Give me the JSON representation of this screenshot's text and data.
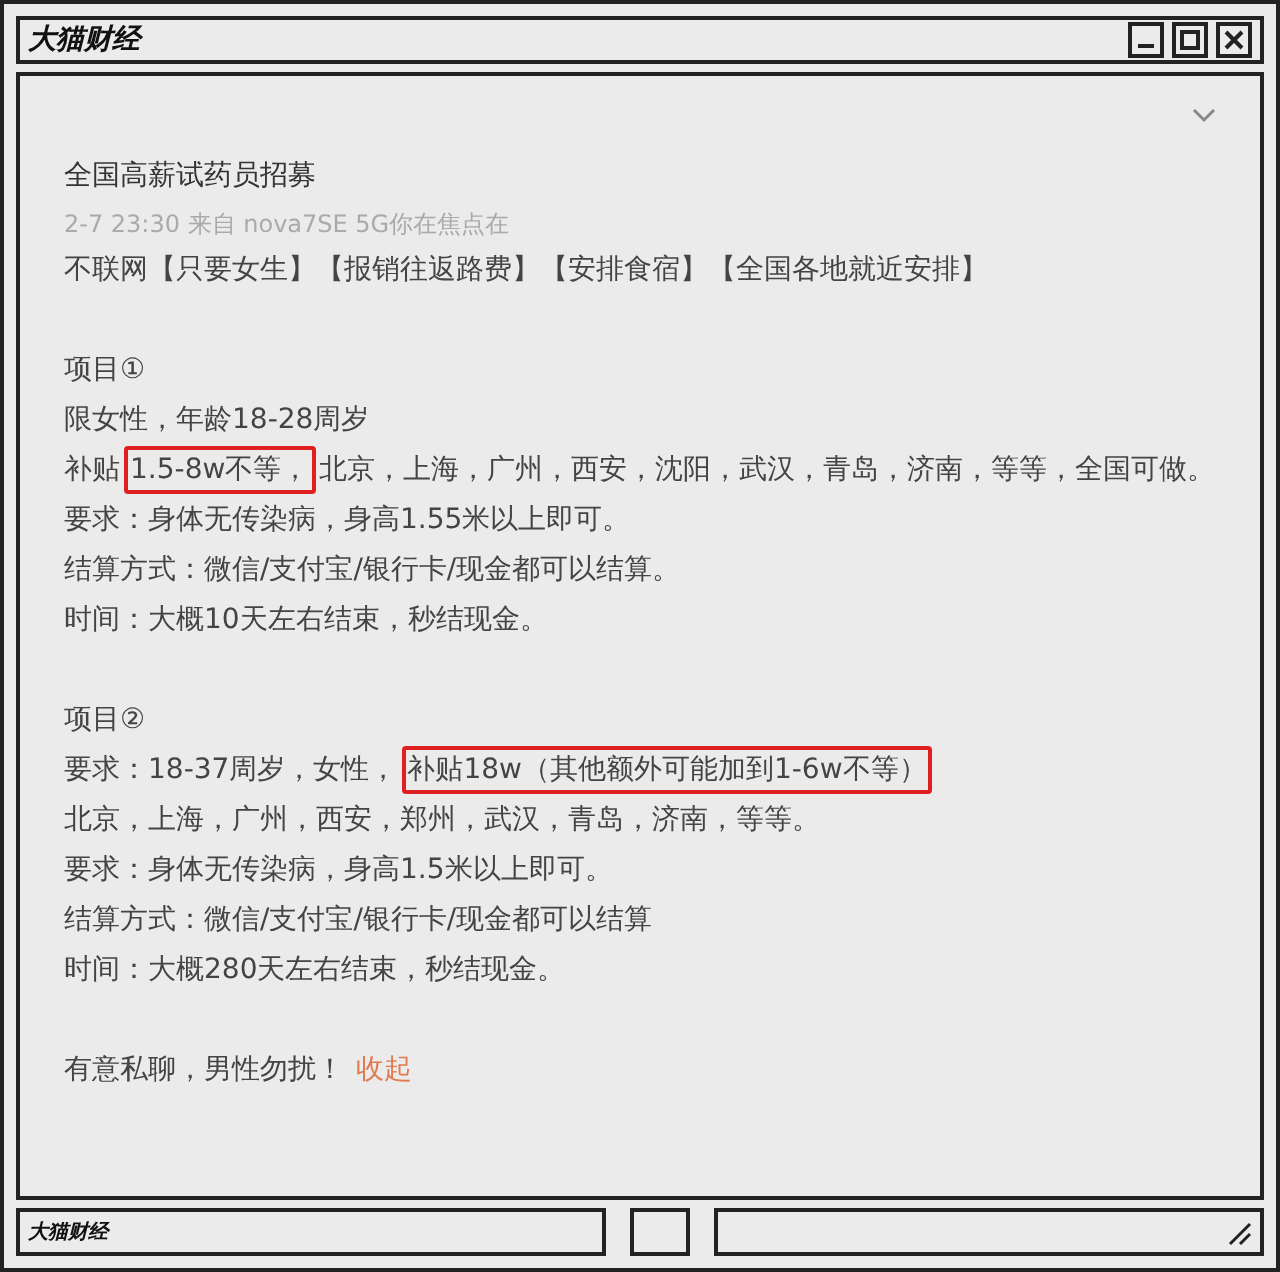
{
  "window": {
    "title": "大猫财经"
  },
  "post": {
    "title": "全国高薪试药员招募",
    "meta": "2-7 23:30 来自 nova7SE 5G你在焦点在",
    "tags_line": "不联网【只要女生】【报销往返路费】【安排食宿】【全国各地就近安排】",
    "sections": [
      {
        "heading": "项目①",
        "lines": [
          [
            {
              "text": "限女性，年龄18-28周岁",
              "highlighted": false
            }
          ],
          [
            {
              "text": "补贴",
              "highlighted": false
            },
            {
              "text": "1.5-8w不等，",
              "highlighted": true
            },
            {
              "text": "北京，上海，广州，西安，沈阳，武汉，青岛，济南，等等，全国可做。",
              "highlighted": false
            }
          ],
          [
            {
              "text": "要求：身体无传染病，身高1.55米以上即可。",
              "highlighted": false
            }
          ],
          [
            {
              "text": "结算方式：微信/支付宝/银行卡/现金都可以结算。",
              "highlighted": false
            }
          ],
          [
            {
              "text": "时间：大概10天左右结束，秒结现金。",
              "highlighted": false
            }
          ]
        ]
      },
      {
        "heading": "项目②",
        "lines": [
          [
            {
              "text": "要求：18-37周岁，女性，",
              "highlighted": false
            },
            {
              "text": "补贴18w（其他额外可能加到1-6w不等）",
              "highlighted": true
            }
          ],
          [
            {
              "text": "北京，上海，广州，西安，郑州，武汉，青岛，济南，等等。",
              "highlighted": false
            }
          ],
          [
            {
              "text": "要求：身体无传染病，身高1.5米以上即可。",
              "highlighted": false
            }
          ],
          [
            {
              "text": "结算方式：微信/支付宝/银行卡/现金都可以结算",
              "highlighted": false
            }
          ],
          [
            {
              "text": "时间：大概280天左右结束，秒结现金。",
              "highlighted": false
            }
          ]
        ]
      }
    ],
    "closing": "有意私聊，男性勿扰！",
    "collapse_link": "收起"
  },
  "status_bar": {
    "label": "大猫财经"
  }
}
